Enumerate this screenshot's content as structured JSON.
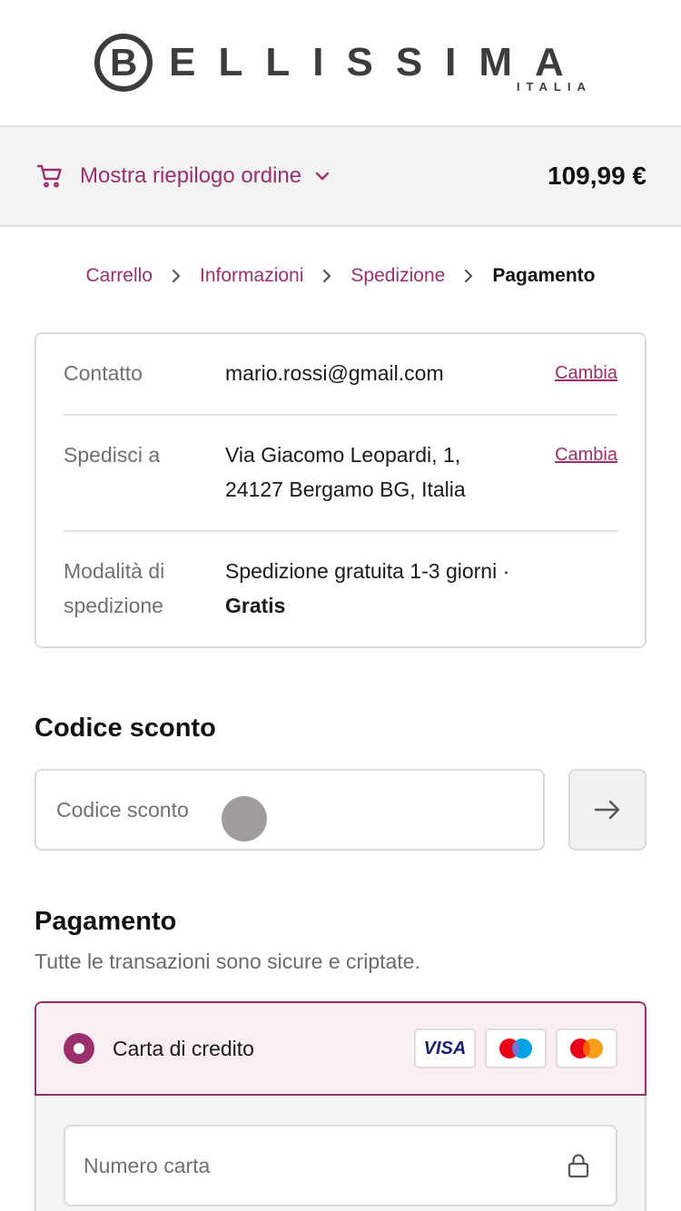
{
  "brand": {
    "logo_letter": "B",
    "logo_main": "ELLISSIMA",
    "logo_sub": "ITALIA"
  },
  "summary": {
    "label": "Mostra riepilogo ordine",
    "total": "109,99 €"
  },
  "breadcrumb": [
    "Carrello",
    "Informazioni",
    "Spedizione",
    "Pagamento"
  ],
  "review": {
    "contact_label": "Contatto",
    "contact_value": "mario.rossi@gmail.com",
    "ship_to_label": "Spedisci a",
    "ship_to_line1": "Via Giacomo Leopardi, 1,",
    "ship_to_line2": "24127 Bergamo BG, Italia",
    "method_label_1": "Modalità di",
    "method_label_2": "spedizione",
    "method_value": "Spedizione gratuita 1-3 giorni ·",
    "method_price": "Gratis",
    "change_link": "Cambia"
  },
  "discount": {
    "title": "Codice sconto",
    "placeholder": "Codice sconto"
  },
  "payment": {
    "title": "Pagamento",
    "subtitle": "Tutte le transazioni sono sicure e criptate.",
    "option_label": "Carta di credito",
    "card_logos": [
      "VISA",
      "maestro",
      "mastercard"
    ],
    "card_number_placeholder": "Numero carta"
  },
  "colors": {
    "accent": "#9b2f6e",
    "muted": "#707070",
    "border": "#d9d9d9"
  }
}
